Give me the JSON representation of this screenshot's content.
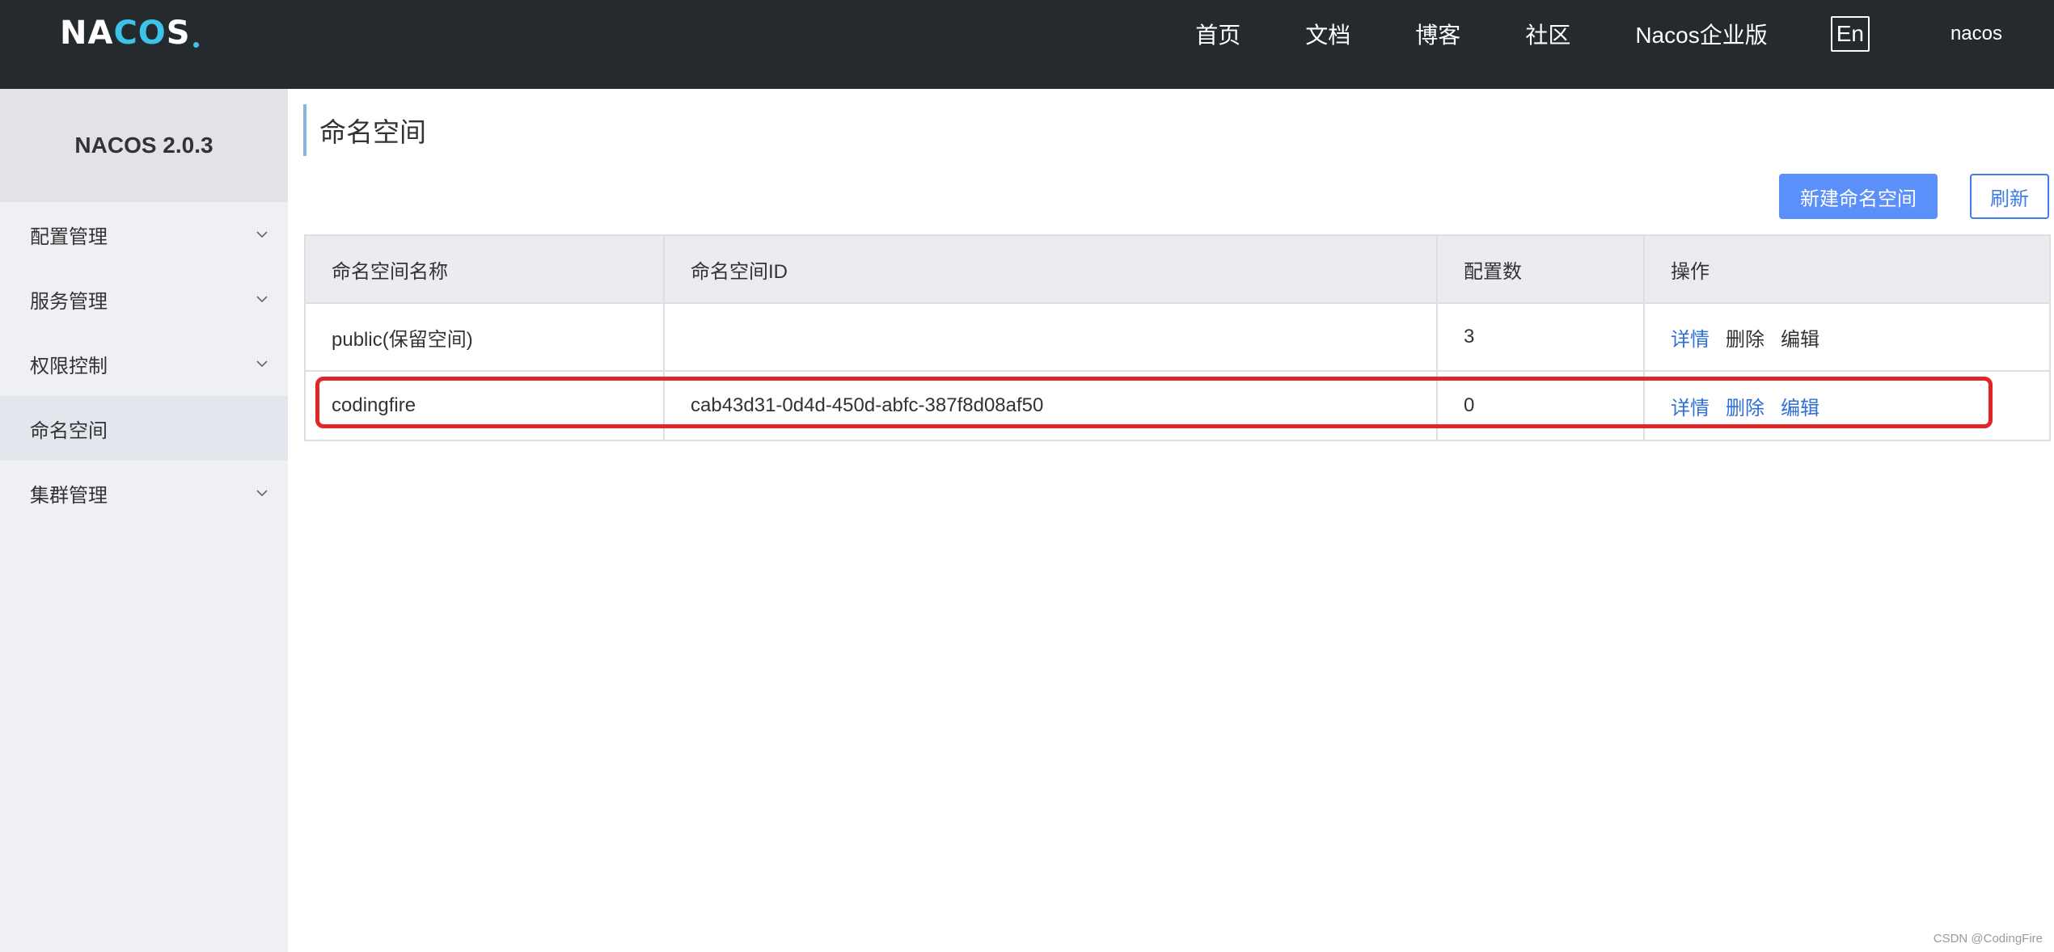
{
  "header": {
    "logo_text_left": "NA",
    "logo_text_accent": "CO",
    "logo_text_right": "S",
    "nav": [
      "首页",
      "文档",
      "博客",
      "社区",
      "Nacos企业版"
    ],
    "lang_toggle": "En",
    "user": "nacos"
  },
  "sidebar": {
    "title": "NACOS 2.0.3",
    "items": [
      {
        "label": "配置管理",
        "expandable": true,
        "active": false
      },
      {
        "label": "服务管理",
        "expandable": true,
        "active": false
      },
      {
        "label": "权限控制",
        "expandable": true,
        "active": false
      },
      {
        "label": "命名空间",
        "expandable": false,
        "active": true
      },
      {
        "label": "集群管理",
        "expandable": true,
        "active": false
      }
    ]
  },
  "main": {
    "title": "命名空间",
    "create_button": "新建命名空间",
    "refresh_button": "刷新",
    "table": {
      "headers": [
        "命名空间名称",
        "命名空间ID",
        "配置数",
        "操作"
      ],
      "rows": [
        {
          "name": "public(保留空间)",
          "id": "",
          "count": "3",
          "ops": [
            "详情",
            "删除",
            "编辑"
          ]
        },
        {
          "name": "codingfire",
          "id": "cab43d31-0d4d-450d-abfc-387f8d08af50",
          "count": "0",
          "ops": [
            "详情",
            "删除",
            "编辑"
          ]
        }
      ]
    }
  },
  "watermark": "CSDN @CodingFire",
  "colors": {
    "topbar": "#252a2f",
    "accent": "#3ec3e8",
    "primary_button": "#5b8ff9",
    "link": "#2f6fd6",
    "highlight": "#e02626"
  }
}
